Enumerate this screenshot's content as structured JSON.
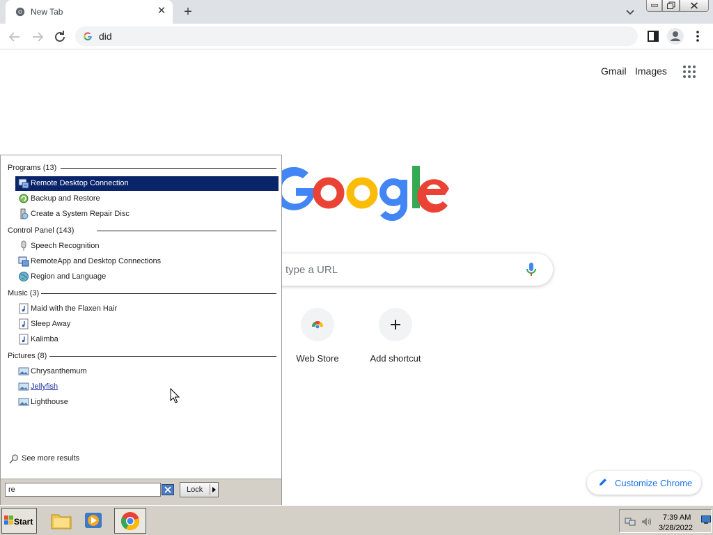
{
  "browser": {
    "tab_title": "New Tab",
    "address_text": "did"
  },
  "ntp": {
    "gmail": "Gmail",
    "images": "Images",
    "search_placeholder": "type a URL",
    "shortcuts": [
      {
        "label": "Web Store",
        "icon": "chrome-web-store-icon"
      },
      {
        "label": "Add shortcut",
        "icon": "plus-icon"
      }
    ],
    "customize_label": "Customize Chrome",
    "logo_letters": "oogle"
  },
  "start_menu": {
    "categories": [
      {
        "label": "Programs (13)",
        "items": [
          {
            "label": "Remote Desktop Connection",
            "icon": "remote-desktop-icon",
            "selected": true
          },
          {
            "label": "Backup and Restore",
            "icon": "backup-icon"
          },
          {
            "label": "Create a System Repair Disc",
            "icon": "repair-disc-icon"
          }
        ]
      },
      {
        "label": "Control Panel (143)",
        "items": [
          {
            "label": "Speech Recognition",
            "icon": "microphone-icon"
          },
          {
            "label": "RemoteApp and Desktop Connections",
            "icon": "remoteapp-icon"
          },
          {
            "label": "Region and Language",
            "icon": "globe-icon"
          }
        ]
      },
      {
        "label": "Music (3)",
        "items": [
          {
            "label": "Maid with the Flaxen Hair",
            "icon": "music-file-icon"
          },
          {
            "label": "Sleep Away",
            "icon": "music-file-icon"
          },
          {
            "label": "Kalimba",
            "icon": "music-file-icon"
          }
        ]
      },
      {
        "label": "Pictures (8)",
        "items": [
          {
            "label": "Chrysanthemum",
            "icon": "picture-file-icon"
          },
          {
            "label": "Jellyfish",
            "icon": "picture-file-icon",
            "hovered": true
          },
          {
            "label": "Lighthouse",
            "icon": "picture-file-icon"
          }
        ]
      }
    ],
    "see_more": "See more results",
    "search_value": "re",
    "lock_label": "Lock"
  },
  "taskbar": {
    "start_label": "Start",
    "time": "7:39 AM",
    "date": "3/28/2022"
  },
  "colors": {
    "selection": "#0a246a",
    "taskbar": "#d4d0c8",
    "google_blue": "#4285f4",
    "google_red": "#ea4335",
    "google_yellow": "#fbbc05",
    "google_green": "#34a853"
  }
}
